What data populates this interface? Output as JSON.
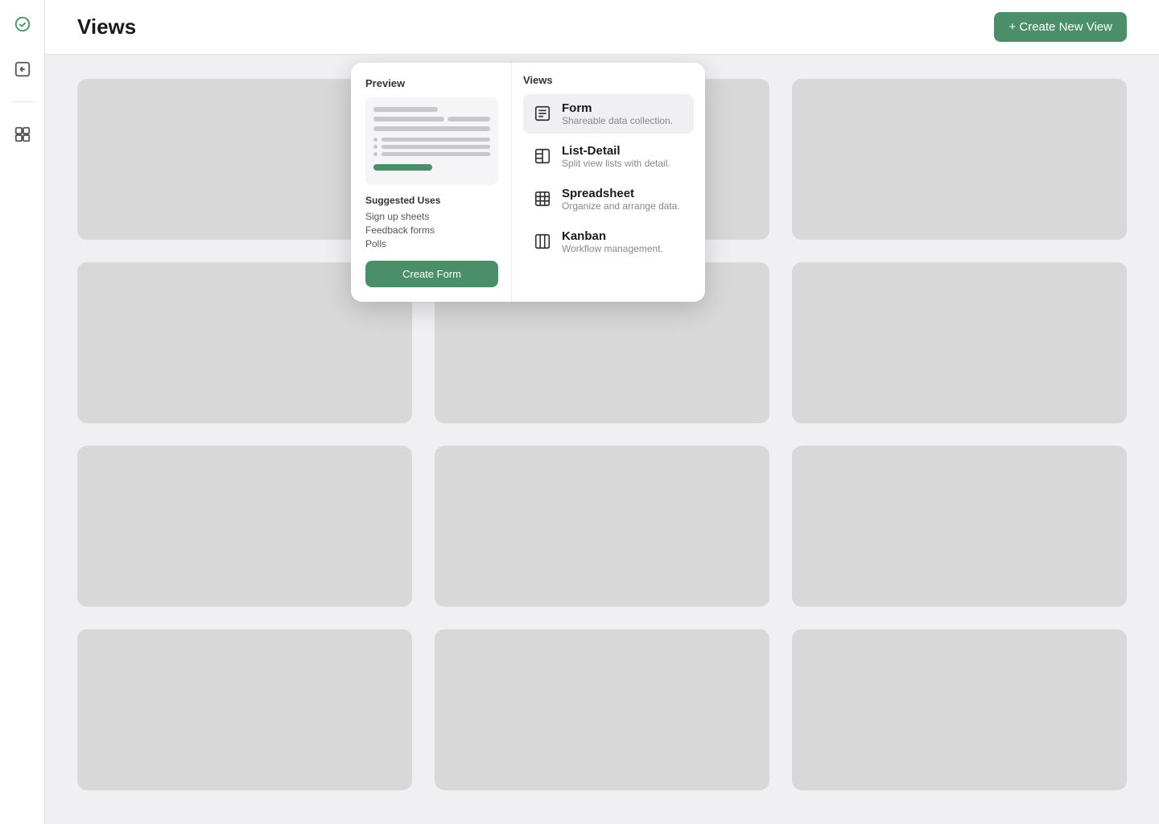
{
  "sidebar": {
    "icons": [
      {
        "name": "logo-icon",
        "label": "Logo"
      },
      {
        "name": "back-icon",
        "label": "Back"
      },
      {
        "name": "divider",
        "label": "Divider"
      },
      {
        "name": "layout-icon",
        "label": "Layout"
      }
    ]
  },
  "header": {
    "title": "Views",
    "create_button_label": "+ Create New View"
  },
  "grid": {
    "cards": [
      {},
      {},
      {},
      {},
      {},
      {},
      {},
      {},
      {},
      {},
      {},
      {}
    ]
  },
  "dropdown": {
    "preview_label": "Preview",
    "views_label": "Views",
    "suggested_uses_label": "Suggested Uses",
    "suggested_uses": [
      "Sign up sheets",
      "Feedback forms",
      "Polls"
    ],
    "create_form_button_label": "Create Form",
    "views": [
      {
        "name": "Form",
        "description": "Shareable data collection.",
        "icon": "form-icon",
        "active": true
      },
      {
        "name": "List-Detail",
        "description": "Split view lists with detail.",
        "icon": "list-detail-icon",
        "active": false
      },
      {
        "name": "Spreadsheet",
        "description": "Organize and arrange data.",
        "icon": "spreadsheet-icon",
        "active": false
      },
      {
        "name": "Kanban",
        "description": "Workflow management.",
        "icon": "kanban-icon",
        "active": false
      }
    ]
  }
}
